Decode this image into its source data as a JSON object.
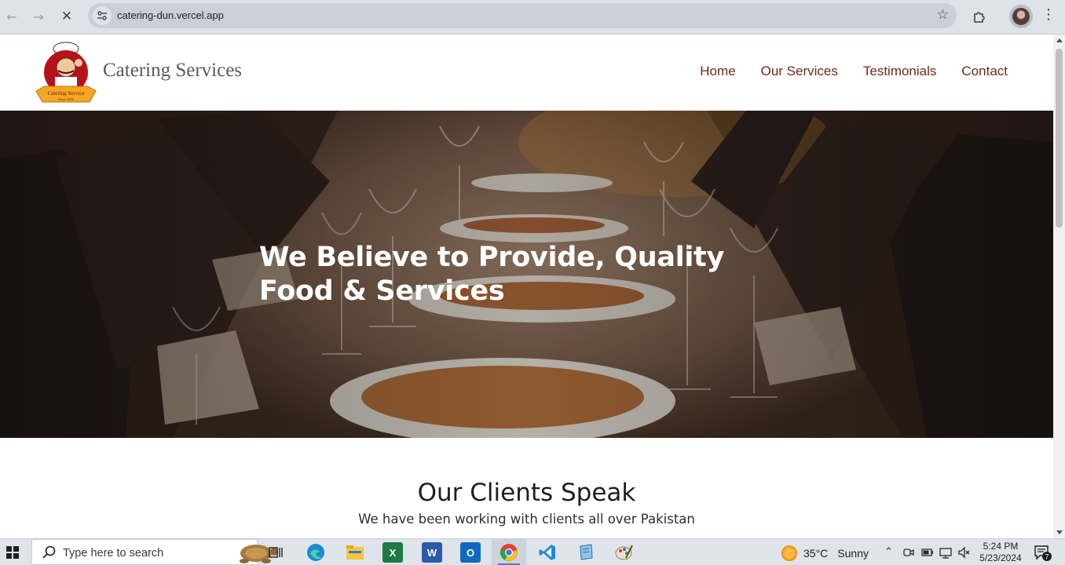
{
  "browser": {
    "url": "catering-dun.vercel.app",
    "icons": [
      "back-arrow-icon",
      "forward-arrow-icon",
      "stop-loading-icon",
      "site-info-icon",
      "bookmark-star-icon",
      "extensions-icon",
      "profile-avatar",
      "more-menu-icon"
    ]
  },
  "header": {
    "brand": "Catering Services",
    "nav": [
      "Home",
      "Our Services",
      "Testimonials",
      "Contact"
    ]
  },
  "hero": {
    "title": "We Believe to Provide, Quality Food & Services"
  },
  "clients": {
    "title": "Our Clients Speak",
    "subtitle": "We have been working with clients all over Pakistan"
  },
  "taskbar": {
    "search_placeholder": "Type here to search",
    "apps": [
      "task-view",
      "edge",
      "file-explorer",
      "excel",
      "word",
      "outlook",
      "chrome",
      "vscode",
      "notepad",
      "paint"
    ],
    "weather": {
      "temp": "35°C",
      "condition": "Sunny"
    },
    "clock": {
      "time": "5:24 PM",
      "date": "5/23/2024"
    },
    "notification_count": "7"
  },
  "colors": {
    "nav_link": "#6b2b1b",
    "chrome_bg": "#dee3ea",
    "taskbar_bg": "#dfe4ea"
  }
}
